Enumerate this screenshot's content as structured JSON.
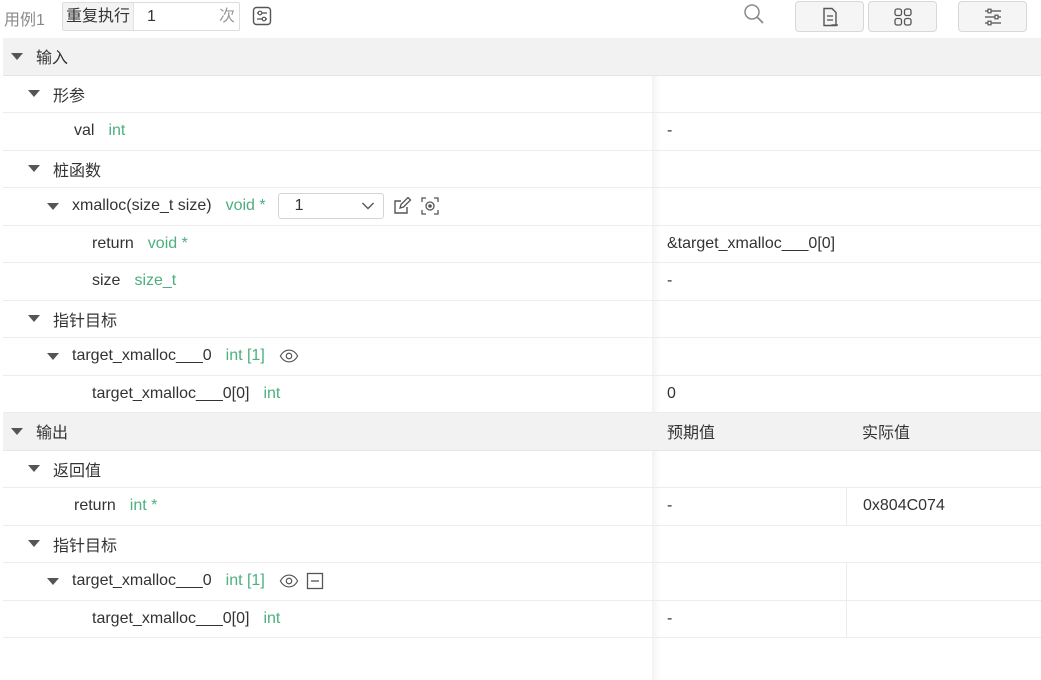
{
  "toolbar": {
    "case_label": "用例1",
    "repeat_label": "重复执行",
    "repeat_value": "1",
    "repeat_unit": "次"
  },
  "input_section": {
    "title": "输入",
    "params": {
      "title": "形参",
      "items": [
        {
          "name": "val",
          "type": "int",
          "value": "-"
        }
      ]
    },
    "stubs": {
      "title": "桩函数",
      "func": {
        "name": "xmalloc(size_t size)",
        "type": "void *",
        "select_value": "1",
        "children": [
          {
            "name": "return",
            "type": "void *",
            "value": "&target_xmalloc___0[0]"
          },
          {
            "name": "size",
            "type": "size_t",
            "value": "-"
          }
        ]
      }
    },
    "pointer_targets": {
      "title": "指针目标",
      "target": {
        "name": "target_xmalloc___0",
        "type": "int [1]",
        "children": [
          {
            "name": "target_xmalloc___0[0]",
            "type": "int",
            "value": "0"
          }
        ]
      }
    }
  },
  "output_section": {
    "title": "输出",
    "expected_header": "预期值",
    "actual_header": "实际值",
    "return_value": {
      "title": "返回值",
      "items": [
        {
          "name": "return",
          "type": "int *",
          "expected": "-",
          "actual": "0x804C074"
        }
      ]
    },
    "pointer_targets": {
      "title": "指针目标",
      "target": {
        "name": "target_xmalloc___0",
        "type": "int [1]",
        "children": [
          {
            "name": "target_xmalloc___0[0]",
            "type": "int",
            "expected": "-",
            "actual": ""
          }
        ]
      }
    }
  },
  "colors": {
    "type_green": "#4caf7d",
    "section_bg": "#f2f2f2",
    "text": "#333333"
  }
}
